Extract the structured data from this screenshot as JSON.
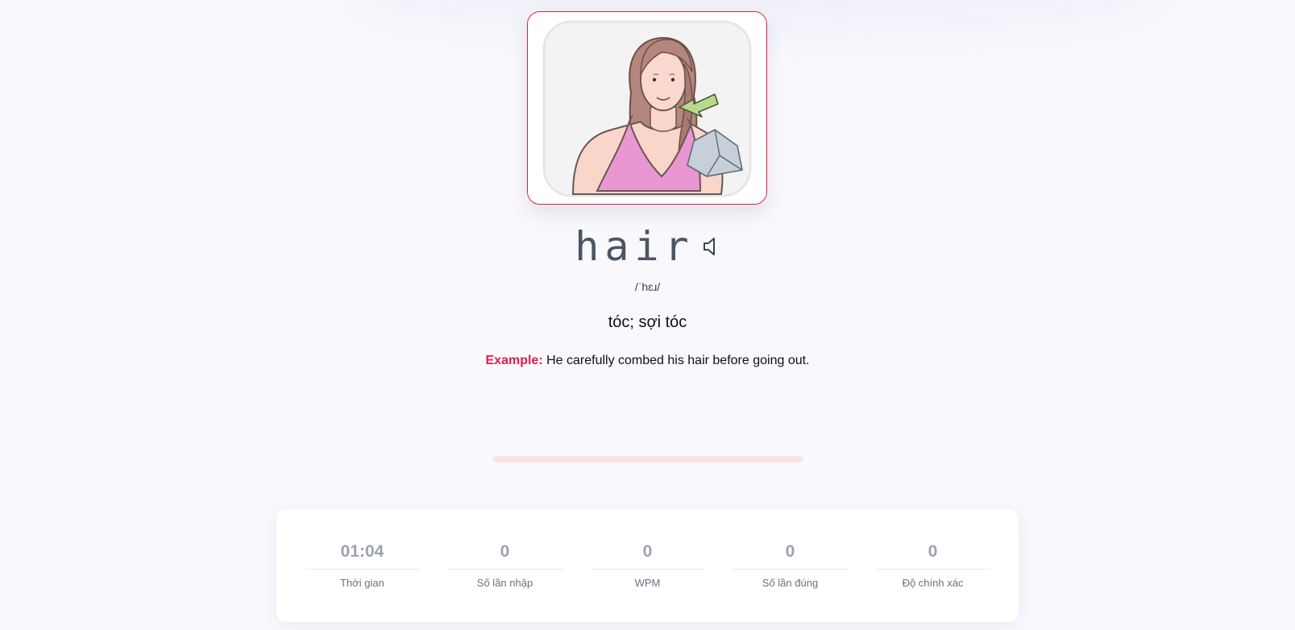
{
  "card": {
    "image_alt": "Illustration of a woman pointing at her long hair",
    "accent_color": "#e11d48"
  },
  "word": {
    "text": "hair",
    "speaker_icon": "speaker-icon",
    "phonetic": "/ˈhɛɹ/",
    "meaning": "tóc; sợi tóc",
    "example_label": "Example:",
    "example_text": "He carefully combed his hair before going out."
  },
  "progress": {
    "fraction": 0
  },
  "stats": [
    {
      "value": "01:04",
      "label": "Thời gian"
    },
    {
      "value": "0",
      "label": "Số lần nhập"
    },
    {
      "value": "0",
      "label": "WPM"
    },
    {
      "value": "0",
      "label": "Số lần đúng"
    },
    {
      "value": "0",
      "label": "Độ chính xác"
    }
  ]
}
